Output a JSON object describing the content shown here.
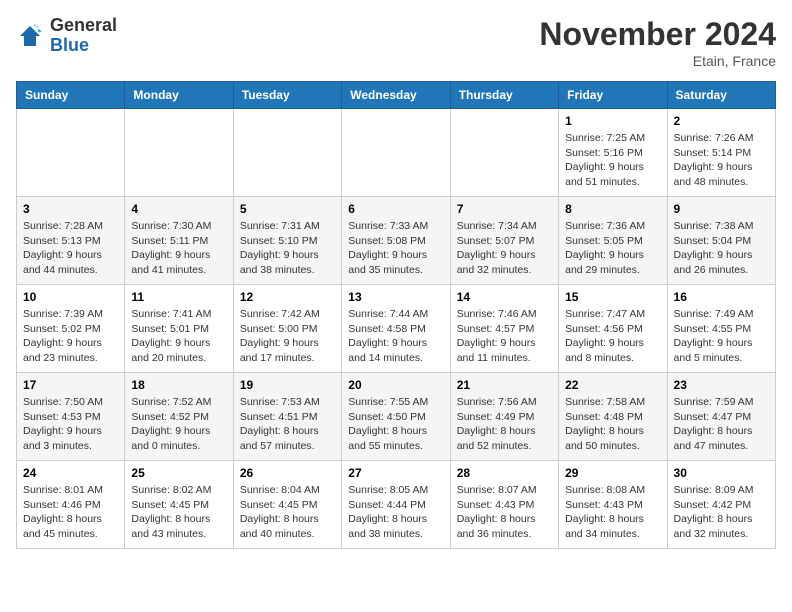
{
  "logo": {
    "general": "General",
    "blue": "Blue"
  },
  "title": "November 2024",
  "location": "Etain, France",
  "days_header": [
    "Sunday",
    "Monday",
    "Tuesday",
    "Wednesday",
    "Thursday",
    "Friday",
    "Saturday"
  ],
  "weeks": [
    [
      {
        "day": "",
        "info": ""
      },
      {
        "day": "",
        "info": ""
      },
      {
        "day": "",
        "info": ""
      },
      {
        "day": "",
        "info": ""
      },
      {
        "day": "",
        "info": ""
      },
      {
        "day": "1",
        "info": "Sunrise: 7:25 AM\nSunset: 5:16 PM\nDaylight: 9 hours and 51 minutes."
      },
      {
        "day": "2",
        "info": "Sunrise: 7:26 AM\nSunset: 5:14 PM\nDaylight: 9 hours and 48 minutes."
      }
    ],
    [
      {
        "day": "3",
        "info": "Sunrise: 7:28 AM\nSunset: 5:13 PM\nDaylight: 9 hours and 44 minutes."
      },
      {
        "day": "4",
        "info": "Sunrise: 7:30 AM\nSunset: 5:11 PM\nDaylight: 9 hours and 41 minutes."
      },
      {
        "day": "5",
        "info": "Sunrise: 7:31 AM\nSunset: 5:10 PM\nDaylight: 9 hours and 38 minutes."
      },
      {
        "day": "6",
        "info": "Sunrise: 7:33 AM\nSunset: 5:08 PM\nDaylight: 9 hours and 35 minutes."
      },
      {
        "day": "7",
        "info": "Sunrise: 7:34 AM\nSunset: 5:07 PM\nDaylight: 9 hours and 32 minutes."
      },
      {
        "day": "8",
        "info": "Sunrise: 7:36 AM\nSunset: 5:05 PM\nDaylight: 9 hours and 29 minutes."
      },
      {
        "day": "9",
        "info": "Sunrise: 7:38 AM\nSunset: 5:04 PM\nDaylight: 9 hours and 26 minutes."
      }
    ],
    [
      {
        "day": "10",
        "info": "Sunrise: 7:39 AM\nSunset: 5:02 PM\nDaylight: 9 hours and 23 minutes."
      },
      {
        "day": "11",
        "info": "Sunrise: 7:41 AM\nSunset: 5:01 PM\nDaylight: 9 hours and 20 minutes."
      },
      {
        "day": "12",
        "info": "Sunrise: 7:42 AM\nSunset: 5:00 PM\nDaylight: 9 hours and 17 minutes."
      },
      {
        "day": "13",
        "info": "Sunrise: 7:44 AM\nSunset: 4:58 PM\nDaylight: 9 hours and 14 minutes."
      },
      {
        "day": "14",
        "info": "Sunrise: 7:46 AM\nSunset: 4:57 PM\nDaylight: 9 hours and 11 minutes."
      },
      {
        "day": "15",
        "info": "Sunrise: 7:47 AM\nSunset: 4:56 PM\nDaylight: 9 hours and 8 minutes."
      },
      {
        "day": "16",
        "info": "Sunrise: 7:49 AM\nSunset: 4:55 PM\nDaylight: 9 hours and 5 minutes."
      }
    ],
    [
      {
        "day": "17",
        "info": "Sunrise: 7:50 AM\nSunset: 4:53 PM\nDaylight: 9 hours and 3 minutes."
      },
      {
        "day": "18",
        "info": "Sunrise: 7:52 AM\nSunset: 4:52 PM\nDaylight: 9 hours and 0 minutes."
      },
      {
        "day": "19",
        "info": "Sunrise: 7:53 AM\nSunset: 4:51 PM\nDaylight: 8 hours and 57 minutes."
      },
      {
        "day": "20",
        "info": "Sunrise: 7:55 AM\nSunset: 4:50 PM\nDaylight: 8 hours and 55 minutes."
      },
      {
        "day": "21",
        "info": "Sunrise: 7:56 AM\nSunset: 4:49 PM\nDaylight: 8 hours and 52 minutes."
      },
      {
        "day": "22",
        "info": "Sunrise: 7:58 AM\nSunset: 4:48 PM\nDaylight: 8 hours and 50 minutes."
      },
      {
        "day": "23",
        "info": "Sunrise: 7:59 AM\nSunset: 4:47 PM\nDaylight: 8 hours and 47 minutes."
      }
    ],
    [
      {
        "day": "24",
        "info": "Sunrise: 8:01 AM\nSunset: 4:46 PM\nDaylight: 8 hours and 45 minutes."
      },
      {
        "day": "25",
        "info": "Sunrise: 8:02 AM\nSunset: 4:45 PM\nDaylight: 8 hours and 43 minutes."
      },
      {
        "day": "26",
        "info": "Sunrise: 8:04 AM\nSunset: 4:45 PM\nDaylight: 8 hours and 40 minutes."
      },
      {
        "day": "27",
        "info": "Sunrise: 8:05 AM\nSunset: 4:44 PM\nDaylight: 8 hours and 38 minutes."
      },
      {
        "day": "28",
        "info": "Sunrise: 8:07 AM\nSunset: 4:43 PM\nDaylight: 8 hours and 36 minutes."
      },
      {
        "day": "29",
        "info": "Sunrise: 8:08 AM\nSunset: 4:43 PM\nDaylight: 8 hours and 34 minutes."
      },
      {
        "day": "30",
        "info": "Sunrise: 8:09 AM\nSunset: 4:42 PM\nDaylight: 8 hours and 32 minutes."
      }
    ]
  ]
}
